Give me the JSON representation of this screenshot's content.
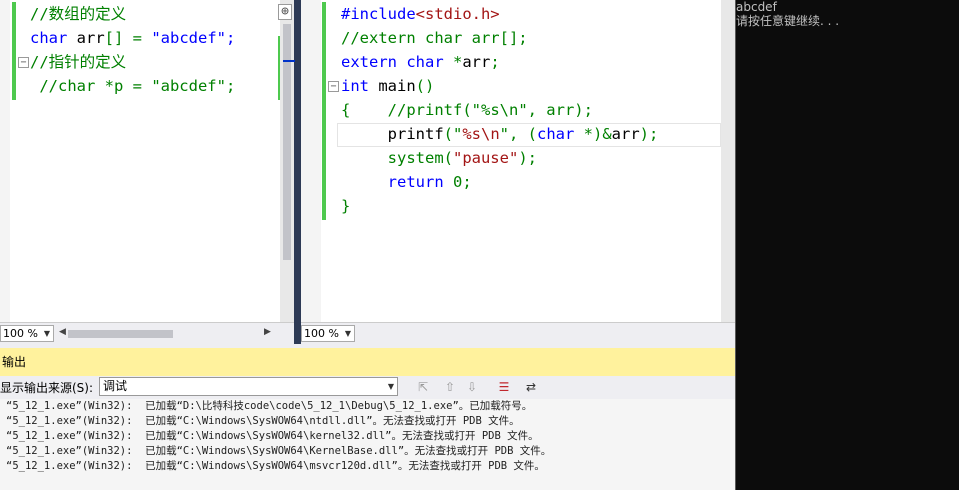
{
  "left_editor": {
    "lines": [
      [
        {
          "t": "//数组的定义",
          "c": "cm"
        }
      ],
      [
        {
          "t": "char ",
          "c": "kw"
        },
        {
          "t": "arr",
          "c": "plain"
        },
        {
          "t": "[] = ",
          "c": "cm"
        },
        {
          "t": "\"abcdef\";",
          "c": "kw"
        }
      ],
      [
        {
          "t": "//指针的定义",
          "c": "cm"
        }
      ],
      [
        {
          "t": " //char *p = \"abcdef\";",
          "c": "cm"
        }
      ]
    ],
    "zoom": "100 %"
  },
  "right_editor": {
    "lines": [
      [
        {
          "t": "#include",
          "c": "kw"
        },
        {
          "t": "<stdio.h>",
          "c": "str"
        }
      ],
      [
        {
          "t": "//extern char arr[];",
          "c": "cm"
        }
      ],
      [
        {
          "t": "extern char ",
          "c": "kw"
        },
        {
          "t": "*",
          "c": "cm"
        },
        {
          "t": "arr",
          "c": "plain"
        },
        {
          "t": ";",
          "c": "cm"
        }
      ],
      [
        {
          "t": "int ",
          "c": "kw"
        },
        {
          "t": "main",
          "c": "plain"
        },
        {
          "t": "()",
          "c": "cm"
        }
      ],
      [
        {
          "t": "{    ",
          "c": "cm"
        },
        {
          "t": "//printf(\"%s\\n\", arr);",
          "c": "cm"
        }
      ],
      [
        {
          "t": "     ",
          "c": "plain"
        },
        {
          "t": "printf",
          "c": "plain"
        },
        {
          "t": "(\"",
          "c": "cm"
        },
        {
          "t": "%s\\n",
          "c": "str"
        },
        {
          "t": "\", (",
          "c": "cm"
        },
        {
          "t": "char ",
          "c": "kw"
        },
        {
          "t": "*)&",
          "c": "cm"
        },
        {
          "t": "arr",
          "c": "plain"
        },
        {
          "t": ");",
          "c": "cm"
        }
      ],
      [
        {
          "t": "     system(",
          "c": "cm"
        },
        {
          "t": "\"pause\"",
          "c": "str"
        },
        {
          "t": ");",
          "c": "cm"
        }
      ],
      [
        {
          "t": "     ",
          "c": "plain"
        },
        {
          "t": "return ",
          "c": "kw"
        },
        {
          "t": "0;",
          "c": "cm"
        }
      ],
      [
        {
          "t": "}",
          "c": "cm"
        }
      ]
    ],
    "zoom": "100 %"
  },
  "output_panel": {
    "title": "输出",
    "source_label": "显示输出来源(S):",
    "source_value": "调试",
    "lines": [
      "“5_12_1.exe”(Win32):  已加载“D:\\比特科技code\\code\\5_12_1\\Debug\\5_12_1.exe”。已加载符号。",
      "“5_12_1.exe”(Win32):  已加载“C:\\Windows\\SysWOW64\\ntdll.dll”。无法查找或打开 PDB 文件。",
      "“5_12_1.exe”(Win32):  已加载“C:\\Windows\\SysWOW64\\kernel32.dll”。无法查找或打开 PDB 文件。",
      "“5_12_1.exe”(Win32):  已加载“C:\\Windows\\SysWOW64\\KernelBase.dll”。无法查找或打开 PDB 文件。",
      "“5_12_1.exe”(Win32):  已加载“C:\\Windows\\SysWOW64\\msvcr120d.dll”。无法查找或打开 PDB 文件。"
    ]
  },
  "console": {
    "lines": [
      "abcdef",
      "请按任意键继续. . ."
    ]
  }
}
